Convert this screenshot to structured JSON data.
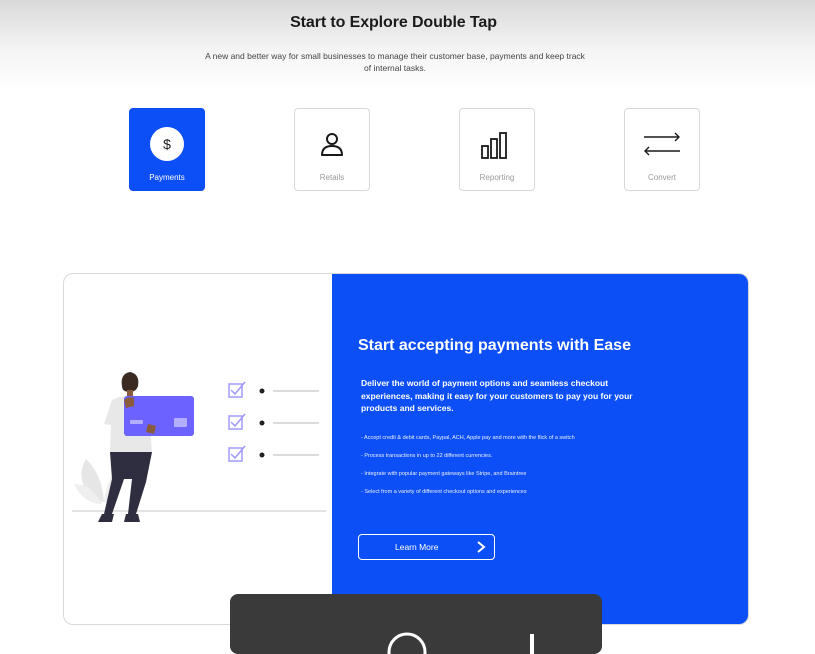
{
  "header": {
    "title": "Start to Explore Double Tap",
    "subtitle": "A new and better way for small businesses to manage their customer base, payments and keep track of internal tasks."
  },
  "tiles": [
    {
      "label": "Payments",
      "icon": "dollar-icon",
      "active": true
    },
    {
      "label": "Retails",
      "icon": "user-icon",
      "active": false
    },
    {
      "label": "Reporting",
      "icon": "bar-chart-icon",
      "active": false
    },
    {
      "label": "Convert",
      "icon": "convert-arrows-icon",
      "active": false
    }
  ],
  "feature": {
    "title": "Start accepting payments with Ease",
    "description": "Deliver the world of payment options and seamless checkout experiences, making it easy for your customers to pay you for your products and services.",
    "bullets": [
      "- Accept credit & debit cards, Paypal, ACH, Apple pay and more with the flick of a switch",
      "- Process transactions in up to 22 different currencies.",
      "- Integrate with popular payment gateways like Stripe, and Braintree",
      "- Select from a variety of different checkout options and experiences"
    ],
    "button_label": "Learn More"
  },
  "colors": {
    "accent": "#0d4ff6",
    "illustration_purple": "#6c63ff",
    "overlay": "#3a3a3a"
  }
}
